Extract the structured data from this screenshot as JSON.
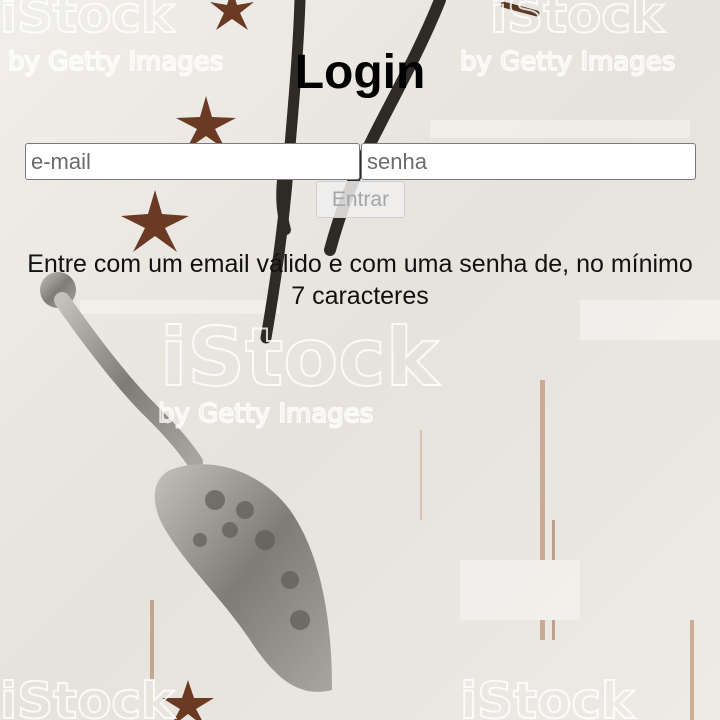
{
  "login": {
    "title": "Login",
    "email_placeholder": "e-mail",
    "password_placeholder": "senha",
    "submit_label": "Entrar",
    "submit_disabled": true,
    "message": "Entre com um email válido e com uma senha de, no mínimo 7 caracteres"
  },
  "background": {
    "watermark_brand": "iStock",
    "watermark_tagline": "by Getty Images",
    "colors": {
      "wood": "#ece9e4",
      "spice": "#6b3a22",
      "vanilla": "#2e2a26",
      "silver": "#8e8a84"
    }
  }
}
